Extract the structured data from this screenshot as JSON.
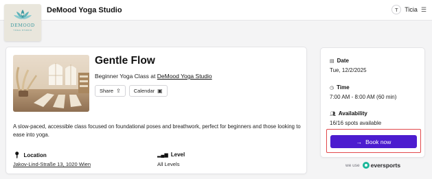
{
  "header": {
    "logo_name": "DEMOOD",
    "logo_sub": "YOGA STUDIO",
    "studio_title": "DeMood Yoga Studio",
    "user_initial": "T",
    "user_name": "Ticia",
    "menu_icon": "hamburger-menu-icon"
  },
  "class": {
    "title": "Gentle Flow",
    "subtitle_prefix": "Beginner Yoga Class at",
    "studio_link": "DeMood Yoga Studio",
    "share_label": "Share",
    "calendar_label": "Calendar",
    "description": "A slow-paced, accessible class focused on foundational poses and breathwork, perfect for beginners and those looking to ease into yoga.",
    "location_label": "Location",
    "location_value": "Jakov-Lind-Straße 13, 1020 Wien",
    "level_label": "Level",
    "level_value": "All Levels"
  },
  "sidebar": {
    "date_label": "Date",
    "date_value": "Tue, 12/2/2025",
    "time_label": "Time",
    "time_value": "7:00 AM - 8:00 AM (60 min)",
    "availability_label": "Availability",
    "availability_value": "16/16 spots available",
    "book_label": "Book now"
  },
  "footer": {
    "we_use": "we use",
    "brand": "eversports"
  },
  "colors": {
    "accent": "#4c1ccf",
    "highlight": "#e2474a",
    "logo_teal": "#3f9aa1",
    "brand_green": "#1bb79a"
  }
}
